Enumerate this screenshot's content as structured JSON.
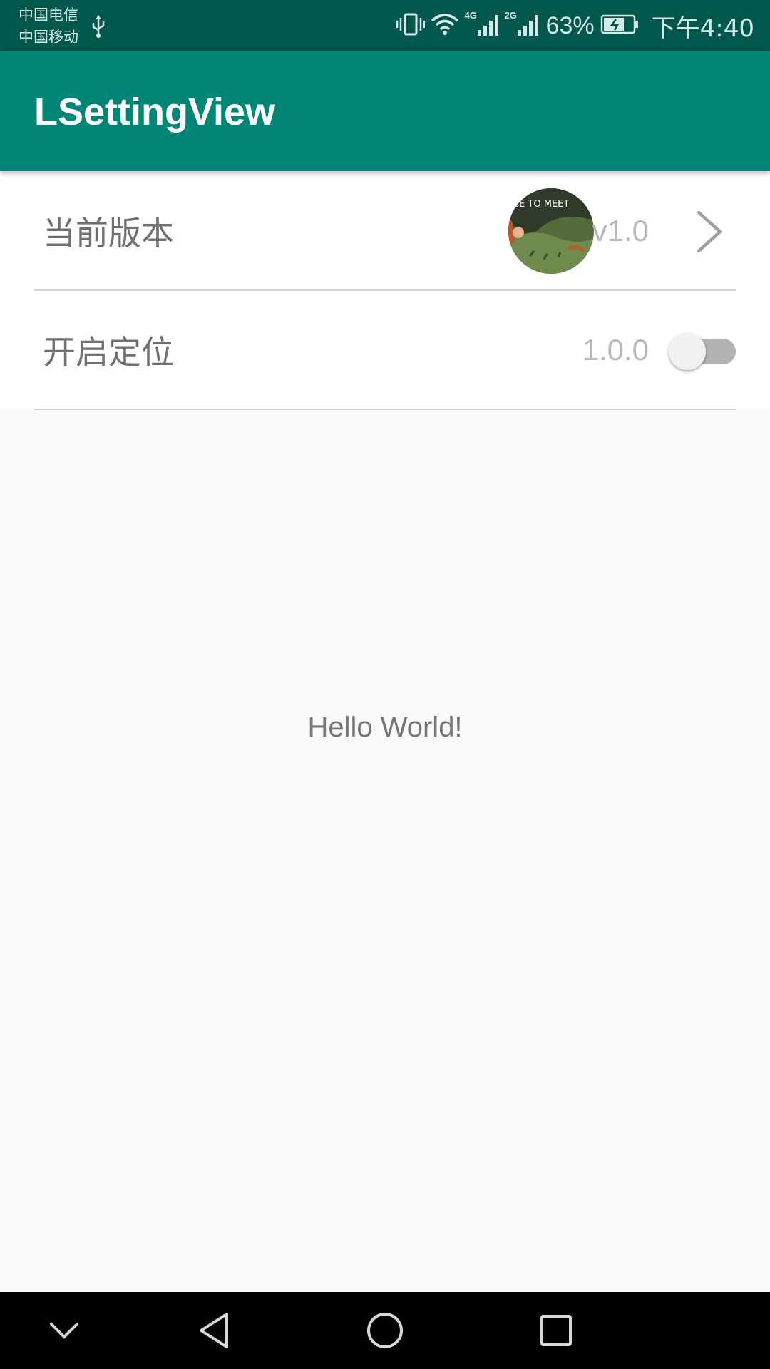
{
  "status_bar": {
    "carrier_1": "中国电信",
    "carrier_2": "中国移动",
    "network_1": "4G",
    "network_2": "2G",
    "battery_percent": "63%",
    "time": "下午4:40",
    "icons": [
      "usb-icon",
      "vibrate-icon",
      "wifi-icon",
      "signal-icon",
      "signal-icon",
      "battery-charging-icon"
    ]
  },
  "app_bar": {
    "title": "LSettingView"
  },
  "settings": {
    "items": [
      {
        "label": "当前版本",
        "value": "v1.0",
        "has_avatar": true,
        "trailing": "chevron-right-icon"
      },
      {
        "label": "开启定位",
        "value": "1.0.0",
        "trailing": "toggle",
        "toggle_on": false
      }
    ]
  },
  "content": {
    "message": "Hello World!"
  },
  "nav_bar": {
    "buttons": [
      "chevron-down-icon",
      "back-icon",
      "home-icon",
      "recents-icon"
    ]
  },
  "colors": {
    "status_bar": "#00574b",
    "app_bar": "#008577",
    "background": "#fafafa",
    "label_text": "#6f6f6f",
    "value_text": "#b8b8b8"
  }
}
